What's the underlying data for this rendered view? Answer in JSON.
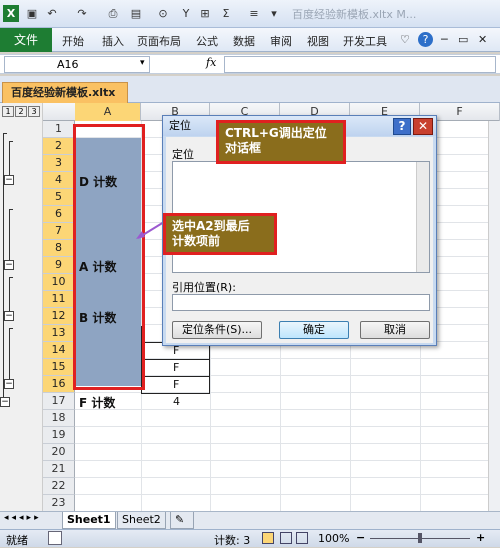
{
  "window": {
    "title": "百度经验新模板.xltx M..."
  },
  "ribbon": {
    "file": "文件",
    "tabs": [
      "开始",
      "插入",
      "页面布局",
      "公式",
      "数据",
      "审阅",
      "视图",
      "开发工具"
    ],
    "help": "?"
  },
  "formula_bar": {
    "name_box": "A16",
    "fx": "fx",
    "content": ""
  },
  "workbook_tab": "百度经验新模板.xltx",
  "outline_levels": [
    "1",
    "2",
    "3"
  ],
  "columns": [
    "A",
    "B",
    "C",
    "D",
    "E",
    "F"
  ],
  "rows": [
    "1",
    "2",
    "3",
    "4",
    "5",
    "6",
    "7",
    "8",
    "9",
    "10",
    "11",
    "12",
    "13",
    "14",
    "15",
    "16",
    "17",
    "18",
    "19",
    "20",
    "21",
    "22",
    "23"
  ],
  "selected_rows": [
    "2",
    "3",
    "4",
    "5",
    "6",
    "7",
    "8",
    "9",
    "10",
    "11",
    "12",
    "13",
    "14",
    "15",
    "16"
  ],
  "cells_a": [
    {
      "row": "4",
      "text": "D 计数"
    },
    {
      "row": "9",
      "text": "A 计数"
    },
    {
      "row": "12",
      "text": "B 计数"
    },
    {
      "row": "17",
      "text": "F 计数"
    }
  ],
  "cells_b": [
    {
      "row": "14",
      "text": "F"
    },
    {
      "row": "15",
      "text": "F"
    },
    {
      "row": "16",
      "text": "F"
    },
    {
      "row": "17",
      "text": "4"
    }
  ],
  "dialog": {
    "title": "定位",
    "goto_label": "定位",
    "reference_label": "引用位置(R):",
    "reference_value": "",
    "special_button": "定位条件(S)...",
    "ok_button": "确定",
    "cancel_button": "取消"
  },
  "callouts": {
    "top": "CTRL+G调出定位\n对话框",
    "left": "选中A2到最后\n计数项前"
  },
  "sheets": [
    "Sheet1",
    "Sheet2"
  ],
  "status": {
    "ready": "就绪",
    "count": "计数: 3",
    "zoom": "100%"
  }
}
